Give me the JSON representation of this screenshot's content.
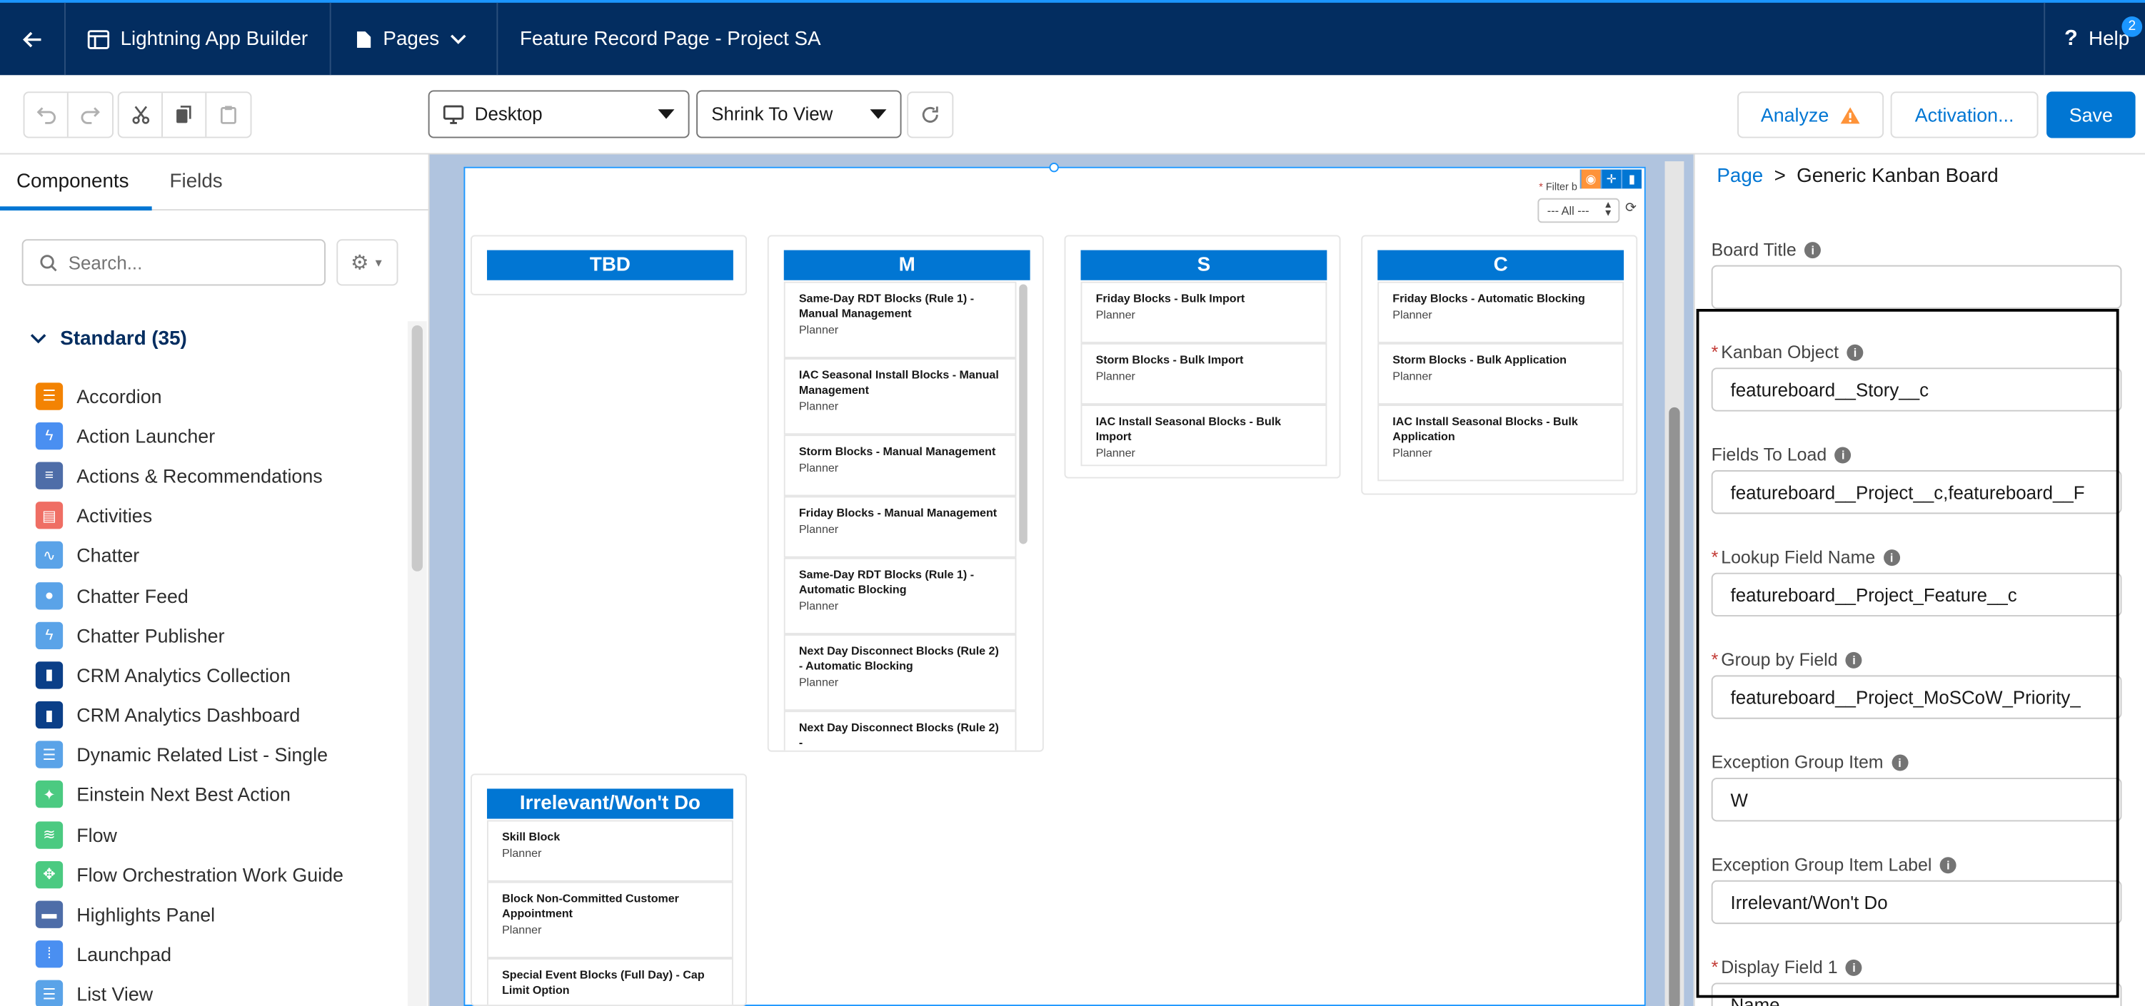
{
  "topnav": {
    "app_label": "Lightning App Builder",
    "pages_label": "Pages",
    "page_title": "Feature Record Page - Project SA",
    "help_label": "Help",
    "help_badge": "2"
  },
  "toolbar": {
    "device_label": "Desktop",
    "zoom_label": "Shrink To View",
    "analyze_label": "Analyze",
    "activation_label": "Activation...",
    "save_label": "Save"
  },
  "left_panel": {
    "tabs": [
      "Components",
      "Fields"
    ],
    "search_placeholder": "Search...",
    "section_label": "Standard (35)",
    "components": [
      {
        "label": "Accordion",
        "icon": "accordion-icon",
        "color": "#f38303"
      },
      {
        "label": "Action Launcher",
        "icon": "lightning-bolt-icon",
        "color": "#4a8ff1"
      },
      {
        "label": "Actions & Recommendations",
        "icon": "list-icon",
        "color": "#4e6da8"
      },
      {
        "label": "Activities",
        "icon": "clipboard-icon",
        "color": "#ef6e64"
      },
      {
        "label": "Chatter",
        "icon": "pulse-icon",
        "color": "#5aa3e8"
      },
      {
        "label": "Chatter Feed",
        "icon": "chat-bubbles-icon",
        "color": "#5aa3e8"
      },
      {
        "label": "Chatter Publisher",
        "icon": "lightning-bolt-icon",
        "color": "#5aa3e8"
      },
      {
        "label": "CRM Analytics Collection",
        "icon": "bar-chart-icon",
        "color": "#0b3f88"
      },
      {
        "label": "CRM Analytics Dashboard",
        "icon": "bar-chart-icon",
        "color": "#0b3f88"
      },
      {
        "label": "Dynamic Related List - Single",
        "icon": "document-list-icon",
        "color": "#5aa3e8"
      },
      {
        "label": "Einstein Next Best Action",
        "icon": "person-star-icon",
        "color": "#4bca81"
      },
      {
        "label": "Flow",
        "icon": "flow-icon",
        "color": "#4bca81"
      },
      {
        "label": "Flow Orchestration Work Guide",
        "icon": "orchestration-icon",
        "color": "#4bca81"
      },
      {
        "label": "Highlights Panel",
        "icon": "panel-icon",
        "color": "#4e6da8"
      },
      {
        "label": "Launchpad",
        "icon": "grid-icon",
        "color": "#4a8ff1"
      },
      {
        "label": "List View",
        "icon": "list-view-icon",
        "color": "#5aa3e8"
      }
    ]
  },
  "canvas": {
    "filter_label": "Filter b",
    "filter_value": "--- All ---",
    "columns": [
      {
        "title": "TBD",
        "cards": []
      },
      {
        "title": "M",
        "cards": [
          {
            "title": "Same-Day RDT Blocks (Rule 1) - Manual Management",
            "sub": "Planner"
          },
          {
            "title": "IAC Seasonal Install Blocks - Manual Management",
            "sub": "Planner"
          },
          {
            "title": "Storm Blocks - Manual Management",
            "sub": "Planner"
          },
          {
            "title": "Friday Blocks - Manual Management",
            "sub": "Planner"
          },
          {
            "title": "Same-Day RDT Blocks (Rule 1) - Automatic Blocking",
            "sub": "Planner"
          },
          {
            "title": "Next Day Disconnect Blocks (Rule 2) - Automatic Blocking",
            "sub": "Planner"
          },
          {
            "title": "Next Day Disconnect Blocks (Rule 2) -",
            "sub": ""
          }
        ]
      },
      {
        "title": "S",
        "cards": [
          {
            "title": "Friday Blocks - Bulk Import",
            "sub": "Planner"
          },
          {
            "title": "Storm Blocks - Bulk Import",
            "sub": "Planner"
          },
          {
            "title": "IAC Install Seasonal Blocks - Bulk Import",
            "sub": "Planner"
          }
        ]
      },
      {
        "title": "C",
        "cards": [
          {
            "title": "Friday Blocks - Automatic Blocking",
            "sub": "Planner"
          },
          {
            "title": "Storm Blocks - Bulk Application",
            "sub": "Planner"
          },
          {
            "title": "IAC Install Seasonal Blocks - Bulk Application",
            "sub": "Planner"
          }
        ]
      },
      {
        "title": "Irrelevant/Won't Do",
        "cards": [
          {
            "title": "Skill Block",
            "sub": "Planner"
          },
          {
            "title": "Block Non-Committed Customer Appointment",
            "sub": "Planner"
          },
          {
            "title": "Special Event Blocks (Full Day) - Cap Limit Option",
            "sub": ""
          }
        ]
      }
    ]
  },
  "right_panel": {
    "crumb_link": "Page",
    "crumb_sep": ">",
    "crumb_current": "Generic Kanban Board",
    "fields": [
      {
        "label": "Board Title",
        "required": false,
        "value": ""
      },
      {
        "label": "Kanban Object",
        "required": true,
        "value": "featureboard__Story__c"
      },
      {
        "label": "Fields To Load",
        "required": false,
        "value": "featureboard__Project__c,featureboard__F"
      },
      {
        "label": "Lookup Field Name",
        "required": true,
        "value": "featureboard__Project_Feature__c"
      },
      {
        "label": "Group by Field",
        "required": true,
        "value": "featureboard__Project_MoSCoW_Priority_"
      },
      {
        "label": "Exception Group Item",
        "required": false,
        "value": "W"
      },
      {
        "label": "Exception Group Item Label",
        "required": false,
        "value": "Irrelevant/Won't Do"
      },
      {
        "label": "Display Field 1",
        "required": true,
        "value": "Name"
      }
    ]
  }
}
